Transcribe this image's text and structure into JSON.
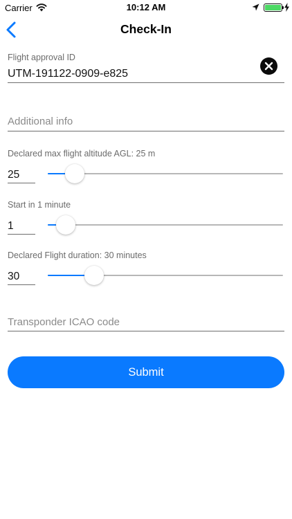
{
  "status_bar": {
    "carrier": "Carrier",
    "time": "10:12 AM",
    "battery_color": "#4cd964"
  },
  "nav": {
    "title": "Check-In",
    "back_icon": "chevron-left-icon",
    "accent_color": "#0a7aff"
  },
  "form": {
    "flight_approval": {
      "label": "Flight approval ID",
      "value": "UTM-191122-0909-e825"
    },
    "additional_info": {
      "placeholder": "Additional info"
    },
    "altitude": {
      "label": "Declared max flight altitude AGL: 25 m",
      "value": "25",
      "level": 0.08
    },
    "start": {
      "label": "Start in 1 minute",
      "value": "1",
      "level": 0.04
    },
    "duration": {
      "label": "Declared Flight duration: 30 minutes",
      "value": "30",
      "level": 0.17
    },
    "transponder": {
      "placeholder": "Transponder ICAO code"
    },
    "submit_label": "Submit"
  }
}
